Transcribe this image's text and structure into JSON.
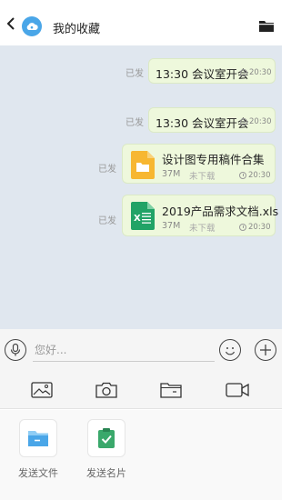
{
  "header": {
    "title": "我的收藏",
    "back_icon": "chevron-left-icon",
    "avatar_icon": "cloud-icon",
    "action_icon": "folder-icon"
  },
  "messages": [
    {
      "status": "已发",
      "text": "13:30 会议室开会",
      "time": "20:30"
    },
    {
      "status": "已发",
      "text": "13:30 会议室开会",
      "time": "20:30"
    },
    {
      "status": "已发",
      "file_name": "设计图专用稿件合集",
      "size": "37M",
      "download": "未下载",
      "time": "20:30",
      "icon": "folder-file-icon",
      "icon_color": "#f7b731"
    },
    {
      "status": "已发",
      "file_name": "2019产品需求文档.xls",
      "size": "37M",
      "download": "未下载",
      "time": "20:30",
      "icon": "excel-file-icon",
      "icon_color": "#21a366"
    }
  ],
  "input": {
    "placeholder": "您好..."
  },
  "actions": [
    {
      "label": "发送文件",
      "icon": "folder-icon",
      "color": "#4aa6e8"
    },
    {
      "label": "发送名片",
      "icon": "clipboard-check-icon",
      "color": "#3aa86b"
    }
  ],
  "colors": {
    "chat_bg": "#e0e7ef",
    "bubble": "#eef8dc",
    "accent": "#4aa6e8"
  }
}
